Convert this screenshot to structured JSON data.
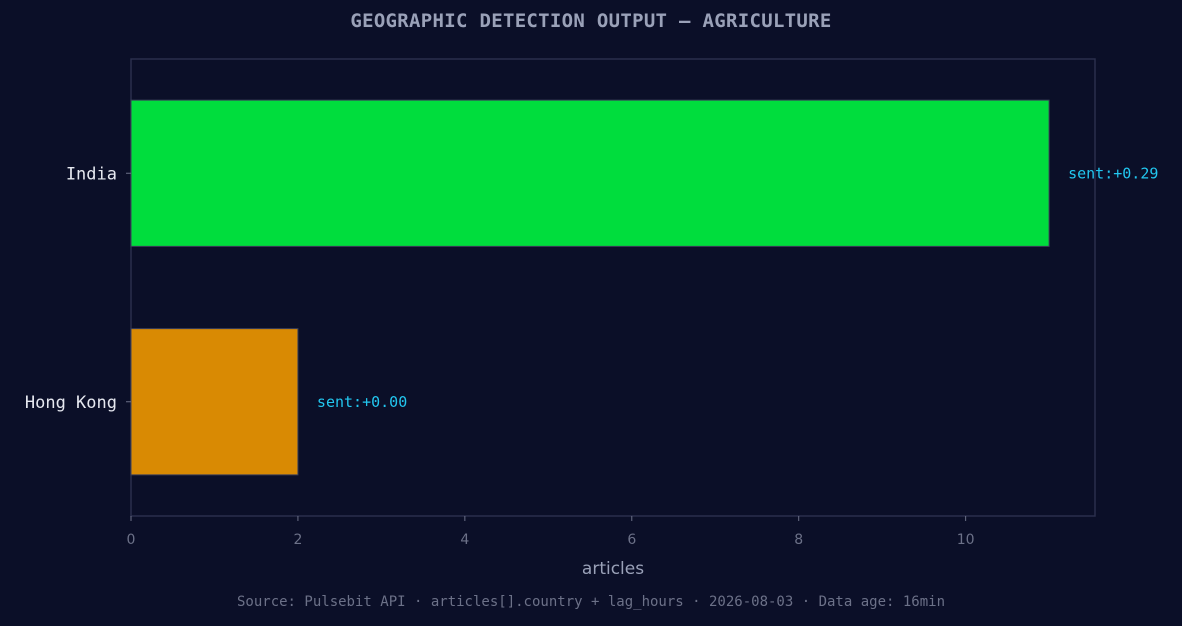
{
  "chart_data": {
    "type": "bar",
    "orientation": "horizontal",
    "title": "GEOGRAPHIC DETECTION OUTPUT — AGRICULTURE",
    "xlabel": "articles",
    "ylabel": "",
    "xlim": [
      0,
      11.55
    ],
    "x_ticks": [
      "0",
      "2",
      "4",
      "6",
      "8",
      "10"
    ],
    "categories": [
      "India",
      "Hong Kong"
    ],
    "values": [
      11,
      2
    ],
    "bar_colors": [
      "#00dd3d",
      "#d98a03"
    ],
    "data_labels": [
      "sent:+0.29",
      "sent:+0.00"
    ],
    "grid": false,
    "legend": "none"
  },
  "footer": {
    "source_text": "Source: Pulsebit API · articles[].country + lag_hours · 2026-08-03 · Data age: 16min"
  },
  "colors": {
    "background": "#0b0f28",
    "axes_frame": "#2a2f4c",
    "data_label": "#22c7f0"
  }
}
